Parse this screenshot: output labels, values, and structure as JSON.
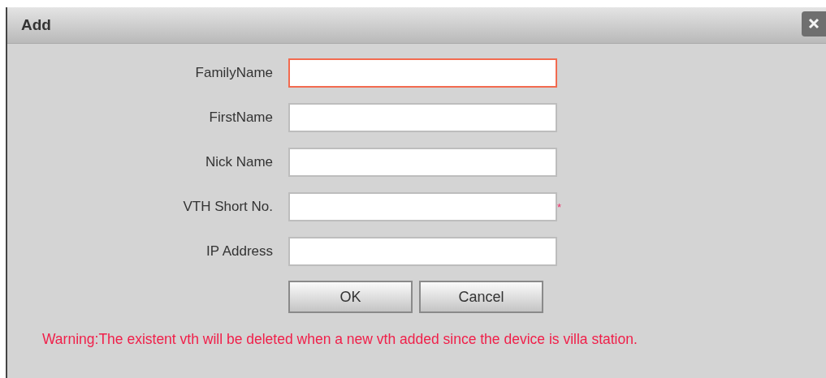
{
  "dialog": {
    "title": "Add"
  },
  "fields": [
    {
      "label": "FamilyName",
      "focused": true
    },
    {
      "label": "FirstName",
      "focused": false
    },
    {
      "label": "Nick Name",
      "focused": false
    },
    {
      "label": "VTH Short No.",
      "focused": false,
      "required_mark": "*"
    },
    {
      "label": "IP Address",
      "focused": false
    }
  ],
  "buttons": [
    "OK",
    "Cancel"
  ],
  "warning": "Warning:The existent vth will be deleted when a new vth added since the device is villa station."
}
